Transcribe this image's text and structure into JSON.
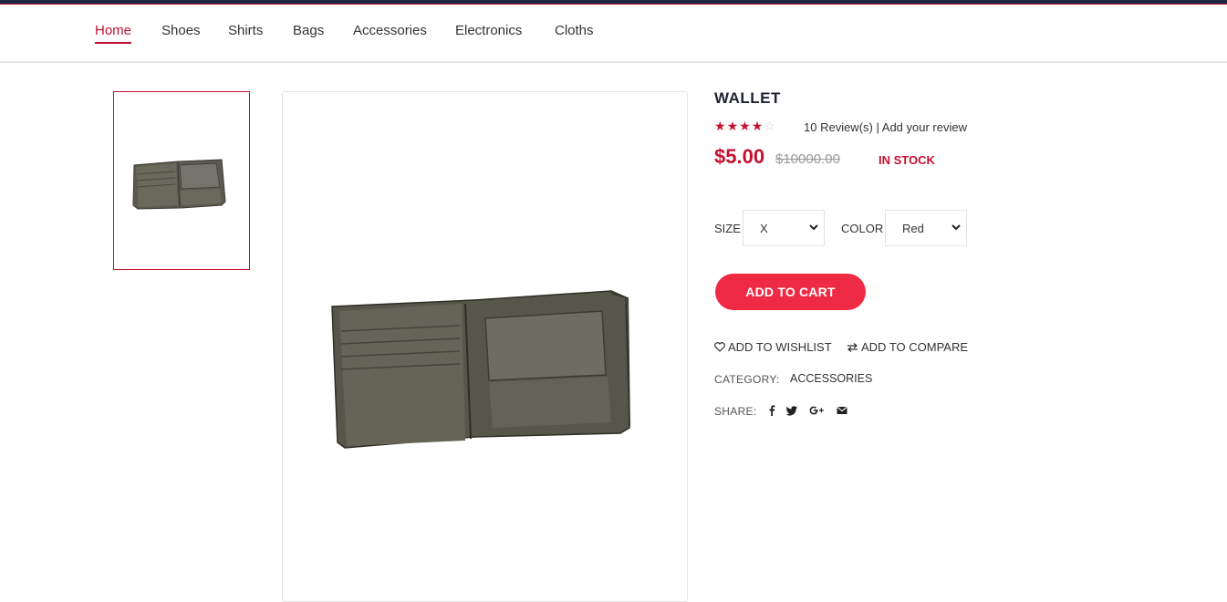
{
  "nav": {
    "items": [
      "Home",
      "Shoes",
      "Shirts",
      "Bags",
      "Accessories",
      "Electronics",
      "Cloths"
    ],
    "active": "Home"
  },
  "product": {
    "title": "WALLET",
    "rating": 4,
    "rating_max": 5,
    "reviews_text": "10 Review(s)",
    "separator": "|",
    "add_review_text": "Add your review",
    "price": "$5.00",
    "old_price": "$10000.00",
    "stock": "IN STOCK"
  },
  "options": {
    "size_label": "SIZE",
    "size_value": "X",
    "color_label": "COLOR",
    "color_value": "Red"
  },
  "actions": {
    "add_to_cart": "ADD TO CART",
    "wishlist": "ADD TO WISHLIST",
    "compare": "ADD TO COMPARE"
  },
  "meta": {
    "category_label": "CATEGORY:",
    "category_value": "ACCESSORIES",
    "share_label": "SHARE:"
  },
  "share_icons": [
    "facebook-icon",
    "twitter-icon",
    "google-plus-icon",
    "envelope-icon"
  ],
  "colors": {
    "accent": "#c4112f",
    "button": "#ee2a44",
    "top_bar": "#1f2540"
  }
}
